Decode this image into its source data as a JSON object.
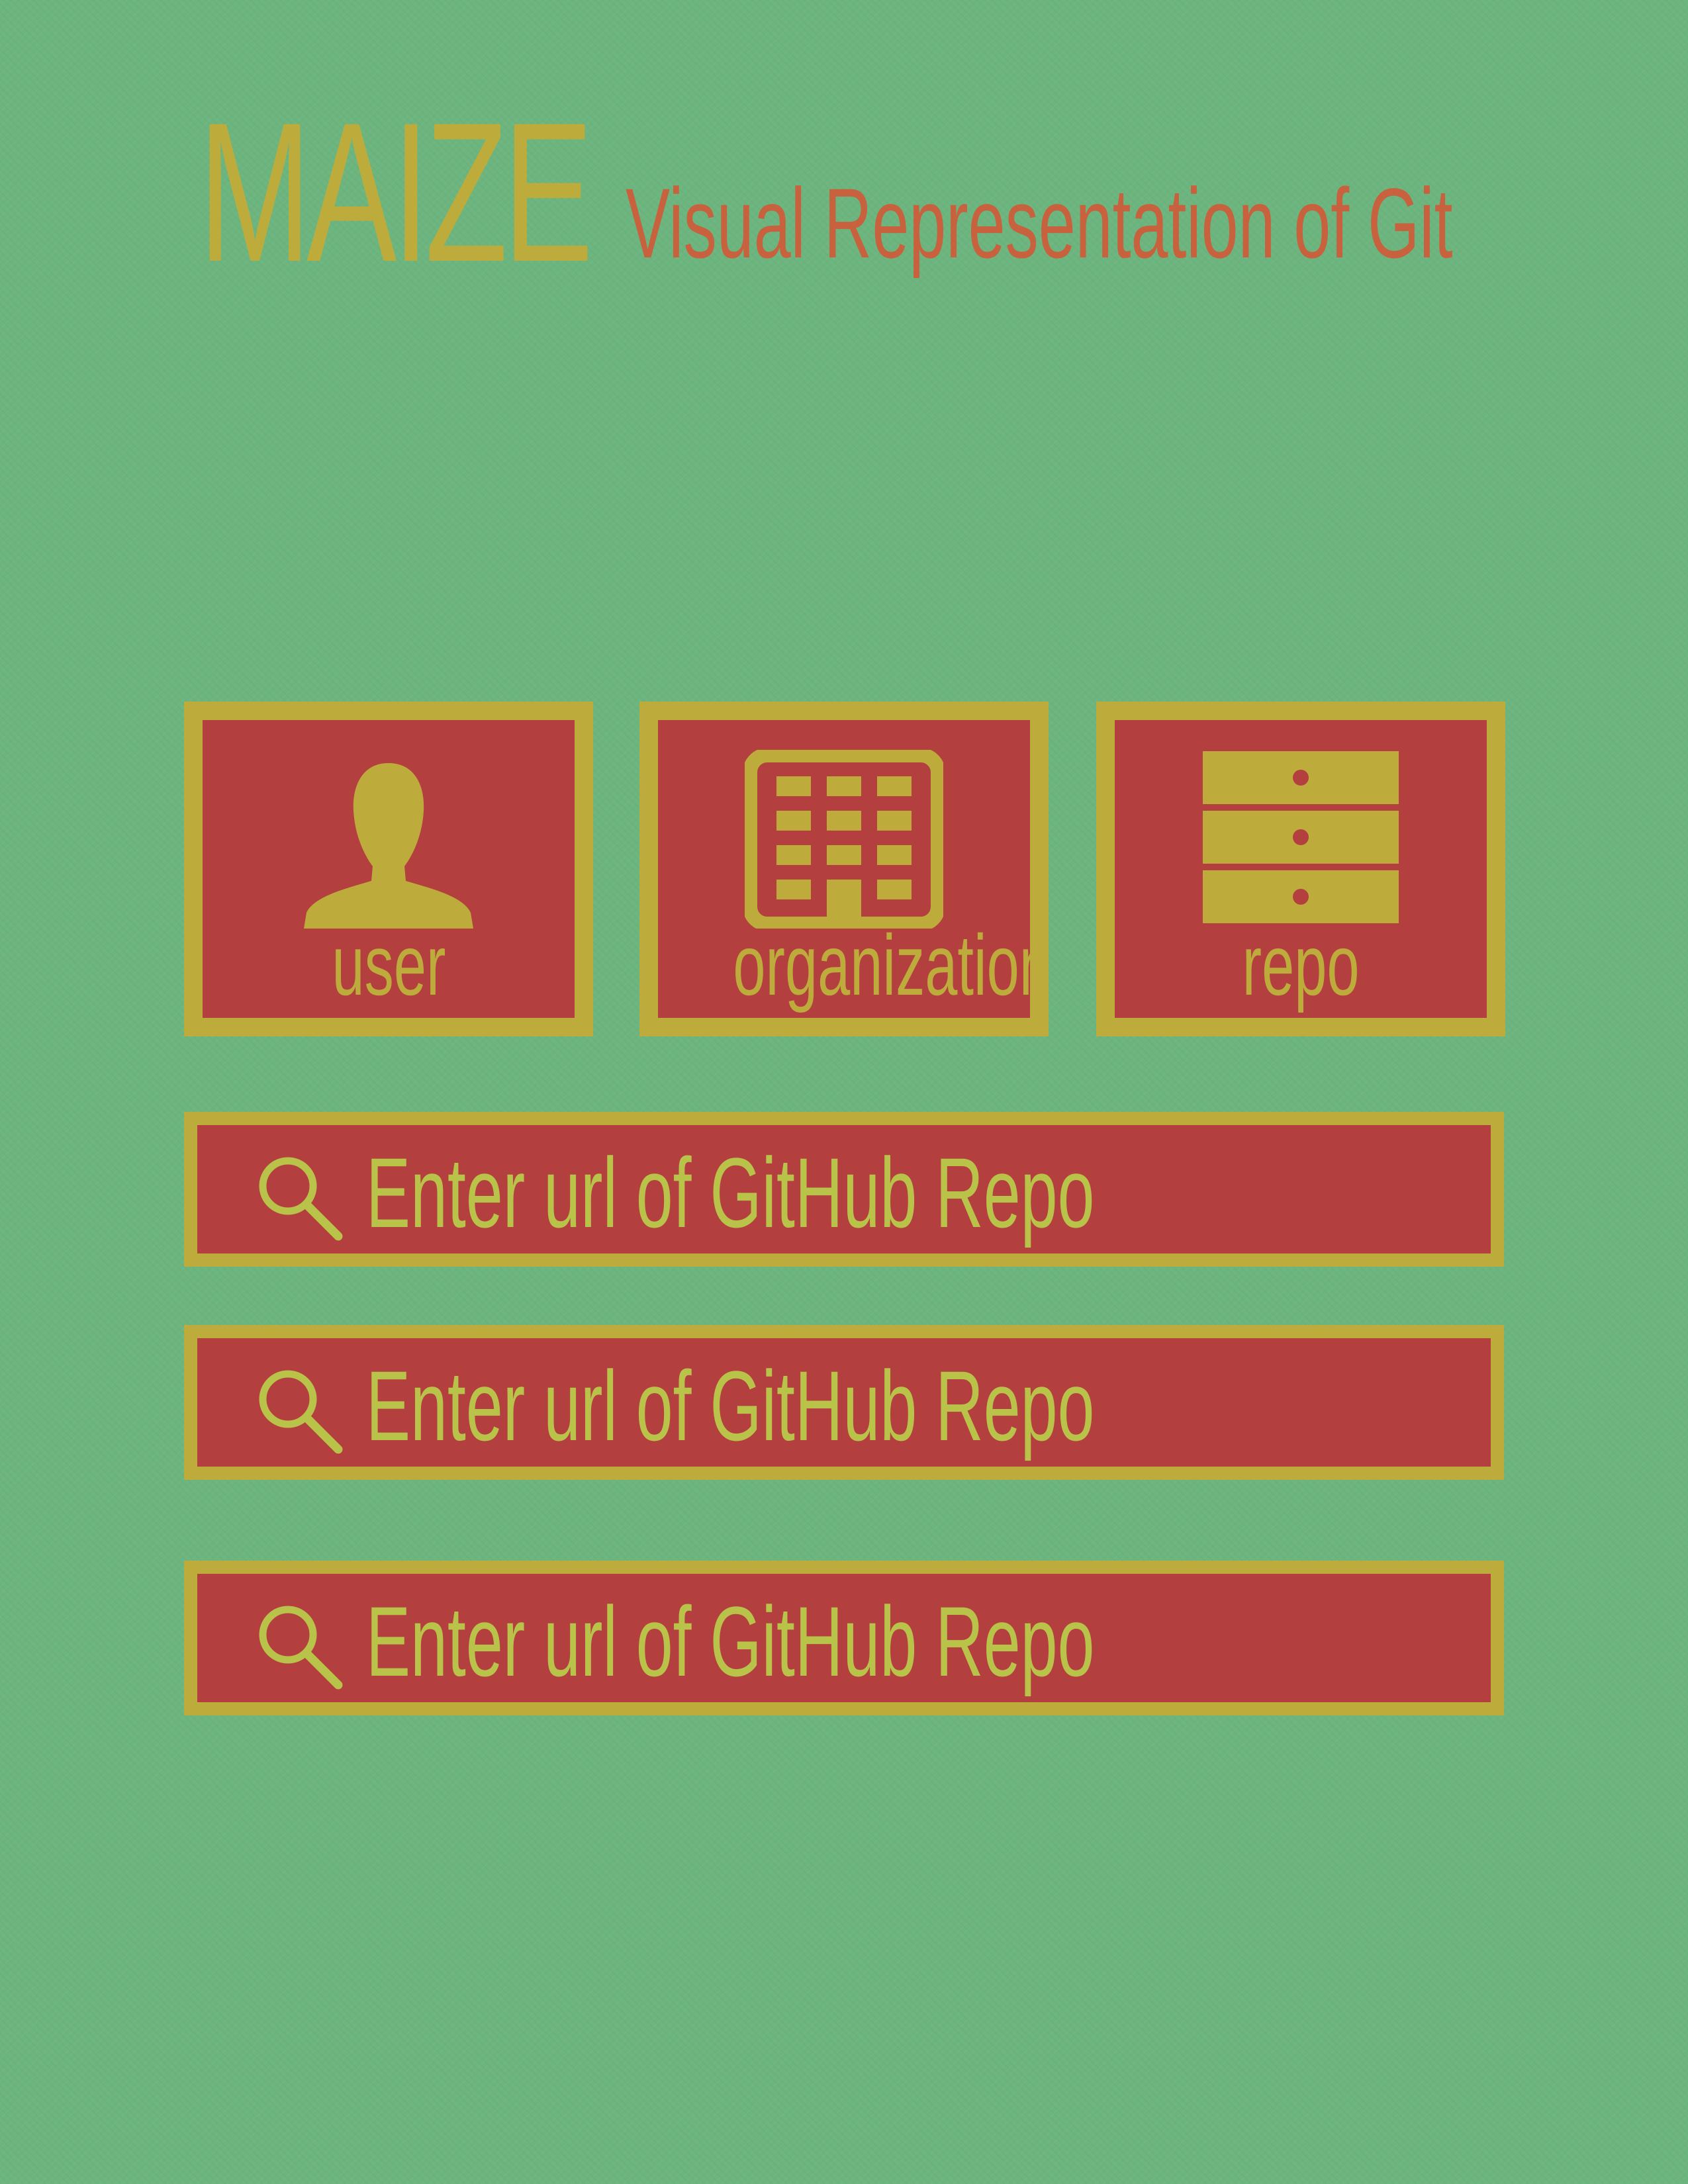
{
  "header": {
    "logo": "MAIZE",
    "tagline": "Visual Representation of Git"
  },
  "tiles": [
    {
      "label": "user",
      "icon": "user-icon"
    },
    {
      "label": "organization",
      "icon": "building-icon"
    },
    {
      "label": "repo",
      "icon": "server-icon"
    }
  ],
  "searches": [
    {
      "placeholder": "Enter url of GitHub Repo",
      "icon": "search-icon"
    },
    {
      "placeholder": "Enter url of GitHub Repo",
      "icon": "search-icon"
    },
    {
      "placeholder": "Enter url of GitHub Repo",
      "icon": "search-icon"
    }
  ],
  "colors": {
    "background": "#6db57f",
    "accent": "#bdac3c",
    "panel": "#b43f3f",
    "tagline": "#c8613d",
    "search_text": "#b9c34a"
  }
}
